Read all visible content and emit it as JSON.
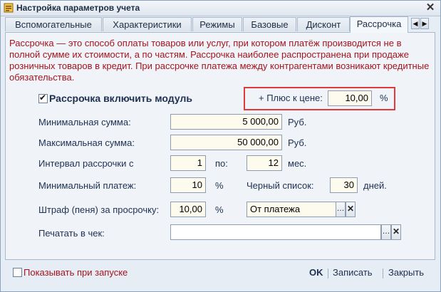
{
  "window": {
    "title": "Настройка параметров учета"
  },
  "tabs": [
    {
      "label": "Вспомогательные"
    },
    {
      "label": "Характеристики"
    },
    {
      "label": "Режимы"
    },
    {
      "label": "Базовые"
    },
    {
      "label": "Дисконт"
    },
    {
      "label": "Рассрочка"
    }
  ],
  "description": "Рассрочка — это способ оплаты товаров или услуг, при котором платёж производится не в полной сумме их стоимости, а по частям. Рассрочка наиболее распространена при продаже розничных товаров в кредит. При рассрочке платежа между контрагентами возникают кредитные обязательства.",
  "enable_module": {
    "label": "Рассрочка включить модуль",
    "checked": true
  },
  "plus_price": {
    "label": "+ Плюс к цене:",
    "value": "10,00",
    "unit": "%"
  },
  "min_sum": {
    "label": "Минимальная сумма:",
    "value": "5 000,00",
    "unit": "Руб."
  },
  "max_sum": {
    "label": "Максимальная сумма:",
    "value": "50 000,00",
    "unit": "Руб."
  },
  "interval": {
    "label": "Интервал рассрочки с",
    "from": "1",
    "to_label": "по:",
    "to": "12",
    "unit": "мес."
  },
  "min_payment": {
    "label": "Минимальный платеж:",
    "value": "10",
    "unit": "%"
  },
  "blacklist": {
    "label": "Черный список:",
    "value": "30",
    "unit": "дней."
  },
  "penalty": {
    "label": "Штраф (пеня) за просрочку:",
    "value": "10,00",
    "unit": "%",
    "mode": "От платежа"
  },
  "print_check": {
    "label": "Печатать в чек:",
    "value": ""
  },
  "show_on_start": {
    "label": "Показывать при запуске",
    "checked": false
  },
  "buttons": {
    "ok": "OK",
    "save": "Записать",
    "close": "Закрыть"
  }
}
